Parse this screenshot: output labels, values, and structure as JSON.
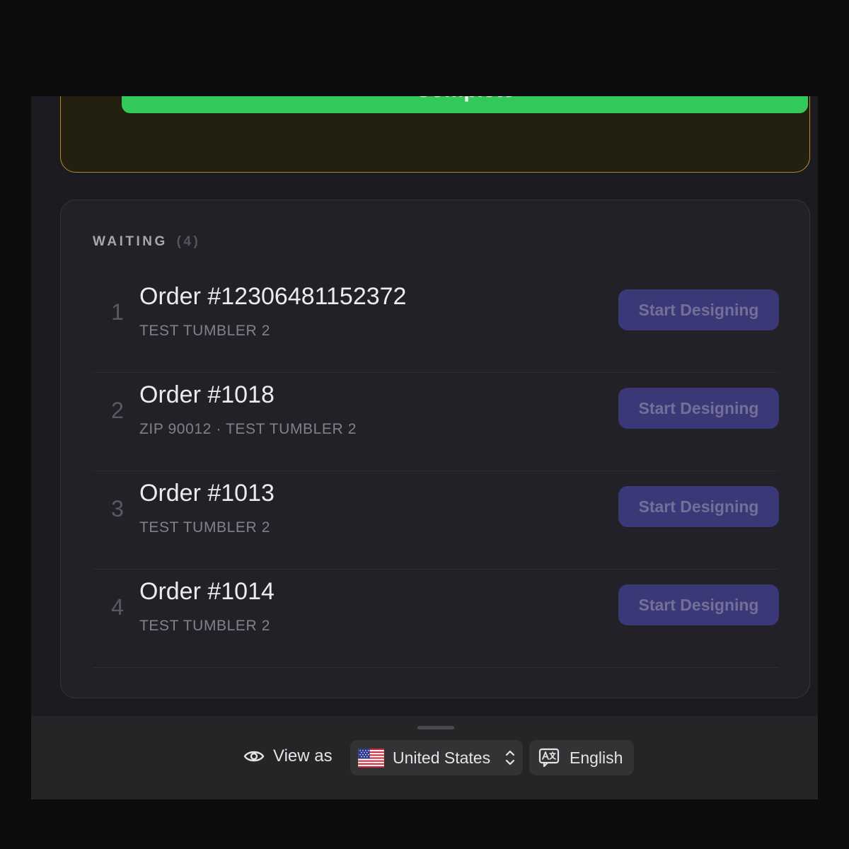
{
  "active": {
    "complete_label": "Complete"
  },
  "waiting": {
    "title": "WAITING",
    "count": "(4)",
    "orders": [
      {
        "position": "1",
        "title": "Order #12306481152372",
        "subtitle": "TEST TUMBLER 2",
        "action": "Start Designing"
      },
      {
        "position": "2",
        "title": "Order #1018",
        "subtitle": "ZIP 90012 · TEST TUMBLER 2",
        "action": "Start Designing"
      },
      {
        "position": "3",
        "title": "Order #1013",
        "subtitle": "TEST TUMBLER 2",
        "action": "Start Designing"
      },
      {
        "position": "4",
        "title": "Order #1014",
        "subtitle": "TEST TUMBLER 2",
        "action": "Start Designing"
      }
    ]
  },
  "footer": {
    "view_as_label": "View as",
    "view_as_icon": "eye-icon",
    "country": "United States",
    "country_icon": "us-flag-icon",
    "language": "English",
    "language_icon": "translate-icon"
  },
  "colors": {
    "complete_green": "#32c85a",
    "active_border": "#b58a26",
    "start_button": "#3b3878"
  }
}
